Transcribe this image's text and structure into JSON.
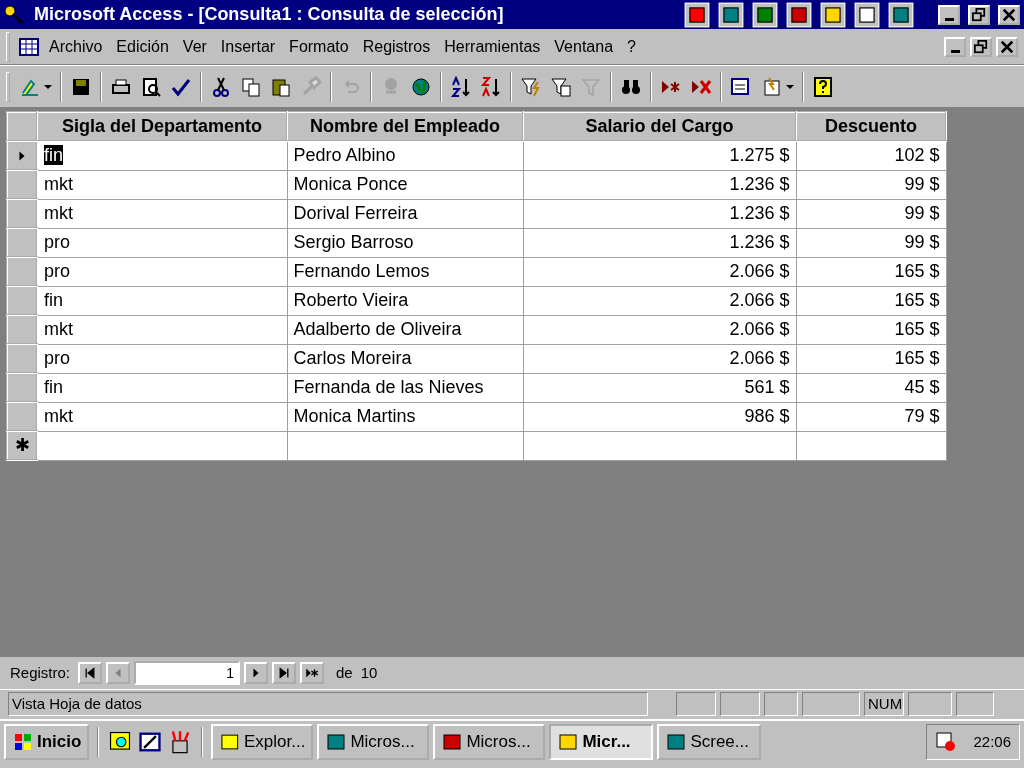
{
  "window": {
    "title": "Microsoft Access - [Consulta1 : Consulta de selección]"
  },
  "menu": [
    {
      "label": "Archivo"
    },
    {
      "label": "Edición"
    },
    {
      "label": "Ver"
    },
    {
      "label": "Insertar"
    },
    {
      "label": "Formato"
    },
    {
      "label": "Registros"
    },
    {
      "label": "Herramientas"
    },
    {
      "label": "Ventana"
    },
    {
      "label": "?"
    }
  ],
  "toolbar": [
    {
      "disabled": false
    },
    {
      "disabled": false
    },
    {
      "disabled": false
    },
    {
      "disabled": false
    },
    {
      "disabled": false
    },
    {
      "disabled": false
    },
    {
      "disabled": false
    },
    {
      "disabled": false
    },
    {
      "disabled": true
    },
    {
      "disabled": true
    },
    {
      "disabled": true
    },
    {
      "disabled": false
    },
    {
      "disabled": false
    },
    {
      "disabled": false
    },
    {
      "disabled": false
    },
    {
      "disabled": false
    },
    {
      "disabled": true
    },
    {
      "disabled": false
    },
    {
      "disabled": false
    },
    {
      "disabled": false
    },
    {
      "disabled": false
    },
    {
      "disabled": false
    },
    {
      "disabled": false
    }
  ],
  "table": {
    "columns": [
      "Sigla del Departamento",
      "Nombre del Empleado",
      "Salario del Cargo",
      "Descuento"
    ],
    "rows": [
      {
        "selected": true,
        "cells": [
          "fin",
          "Pedro Albino",
          "1.275 $",
          "102 $"
        ]
      },
      {
        "selected": false,
        "cells": [
          "mkt",
          "Monica Ponce",
          "1.236 $",
          "99 $"
        ]
      },
      {
        "selected": false,
        "cells": [
          "mkt",
          "Dorival Ferreira",
          "1.236 $",
          "99 $"
        ]
      },
      {
        "selected": false,
        "cells": [
          "pro",
          "Sergio Barroso",
          "1.236 $",
          "99 $"
        ]
      },
      {
        "selected": false,
        "cells": [
          "pro",
          "Fernando Lemos",
          "2.066 $",
          "165 $"
        ]
      },
      {
        "selected": false,
        "cells": [
          "fin",
          "Roberto Vieira",
          "2.066 $",
          "165 $"
        ]
      },
      {
        "selected": false,
        "cells": [
          "mkt",
          "Adalberto de Oliveira",
          "2.066 $",
          "165 $"
        ]
      },
      {
        "selected": false,
        "cells": [
          "pro",
          "Carlos Moreira",
          "2.066 $",
          "165 $"
        ]
      },
      {
        "selected": false,
        "cells": [
          "fin",
          "Fernanda de las Nieves",
          "561 $",
          "45 $"
        ]
      },
      {
        "selected": false,
        "cells": [
          "mkt",
          "Monica Martins",
          "986 $",
          "79 $"
        ]
      }
    ],
    "new_row_marker": "✱"
  },
  "navigator": {
    "label": "Registro:",
    "value": "1",
    "of_label": "de",
    "total": "10"
  },
  "status_bar": {
    "text": "Vista Hoja de datos",
    "indicator": "NUM"
  },
  "taskbar": {
    "start": "Inicio",
    "tasks": [
      {
        "label": "Explor...",
        "selected": false
      },
      {
        "label": "Micros...",
        "selected": false
      },
      {
        "label": "Micros...",
        "selected": false
      },
      {
        "label": "Micr...",
        "selected": true
      },
      {
        "label": "Scree...",
        "selected": false
      }
    ],
    "clock": "22:06"
  }
}
